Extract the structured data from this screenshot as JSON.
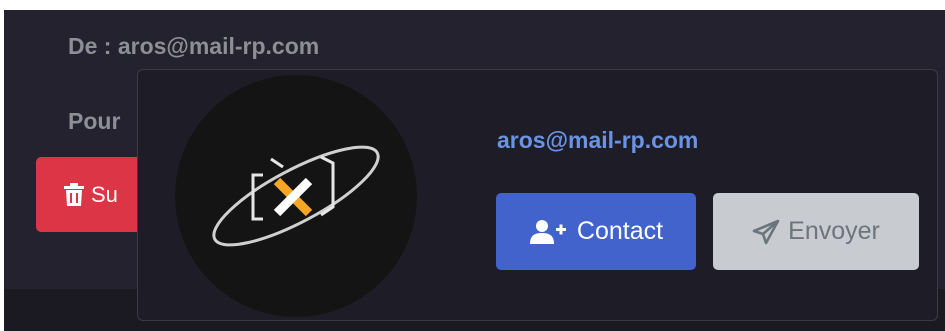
{
  "mail": {
    "from_line": "De : aros@mail-rp.com",
    "to_line": "Pour"
  },
  "actions": {
    "delete_label": "Su"
  },
  "contact_popover": {
    "email": "aros@mail-rp.com",
    "add_contact_label": "Contact",
    "send_label": "Envoyer",
    "avatar_icon": "logo-x-orbit-icon"
  },
  "icons": {
    "delete": "trash-icon",
    "add_contact": "user-plus-icon",
    "send": "paper-plane-icon"
  },
  "colors": {
    "background": "#23222e",
    "popover": "#1e1d27",
    "delete_button": "#dc3545",
    "contact_button": "#4262cc",
    "send_button_disabled": "#c8cbd0",
    "email_link": "#6a93e4",
    "logo_accent": "#f5a623"
  }
}
